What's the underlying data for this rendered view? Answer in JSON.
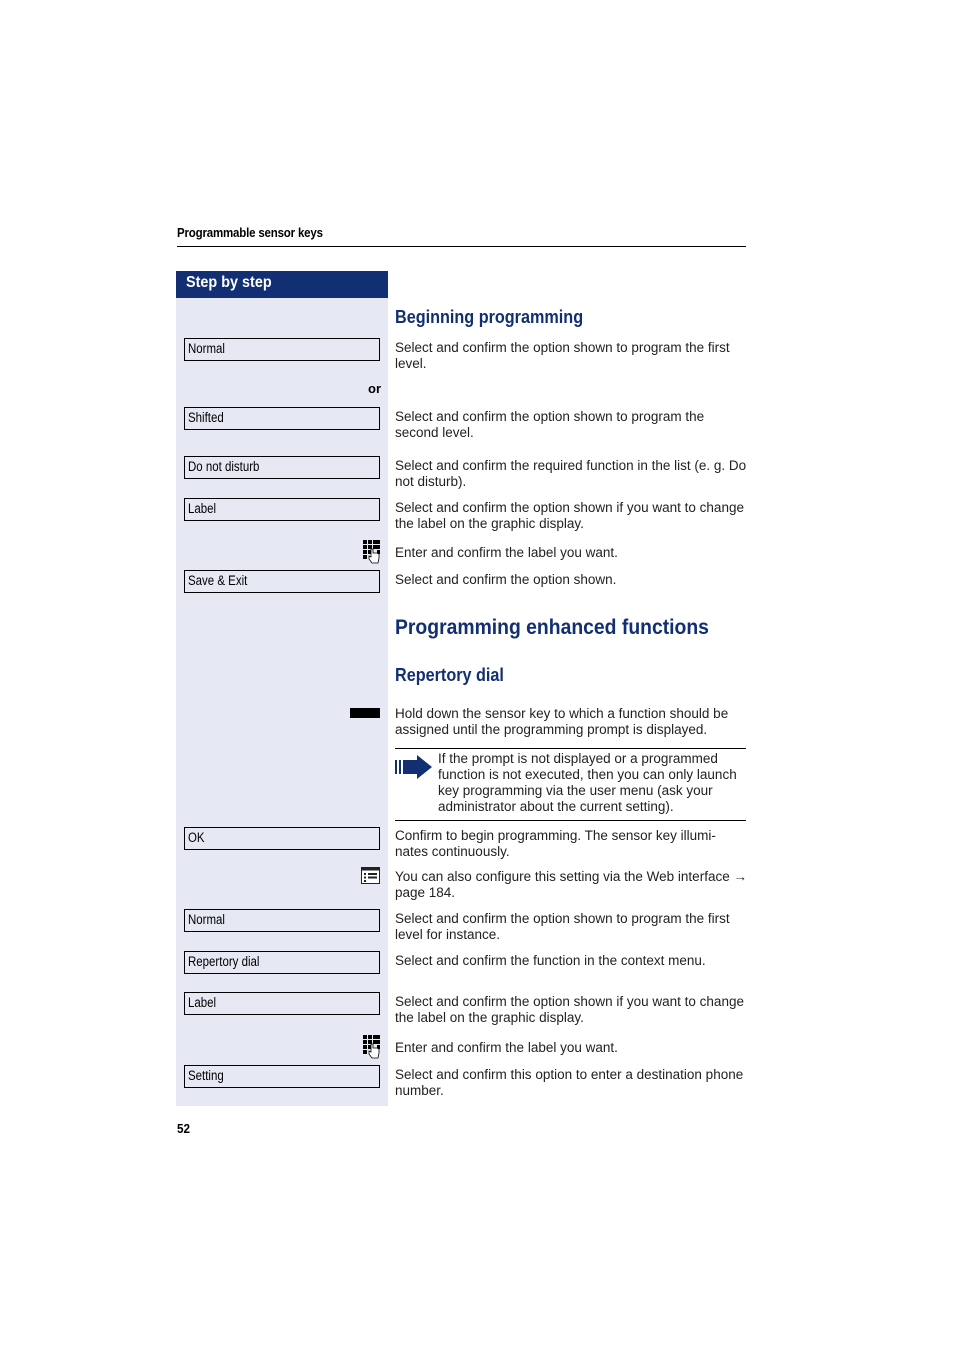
{
  "running_head": "Programmable sensor keys",
  "sidebar": {
    "title": "Step by step"
  },
  "colors": {
    "accent": "#132f73",
    "sidebar_bg": "#e6e9f3"
  },
  "sections": {
    "beginning_programming": {
      "heading": "Beginning programming",
      "steps": [
        {
          "key": "Normal",
          "text": "Select and confirm the option shown to program the first level."
        },
        {
          "connector": "or"
        },
        {
          "key": "Shifted",
          "text": "Select and confirm the option shown to program the second level."
        },
        {
          "key": "Do not disturb",
          "text": "Select and confirm the required function in the list (e. g. Do not disturb)."
        },
        {
          "key": "Label",
          "text": "Select and confirm the option shown if you want to change the label on the graphic display."
        },
        {
          "icon": "keypad-icon",
          "text": "Enter and confirm the label you want."
        },
        {
          "key": "Save & Exit",
          "text": "Select and confirm the option shown."
        }
      ]
    },
    "enhanced": {
      "heading": "Programming enhanced functions",
      "subheading": "Repertory dial",
      "steps": [
        {
          "icon": "sensor-key-icon",
          "text": "Hold down the sensor key to which a function should be assigned until the programming prompt is displayed."
        },
        {
          "note_icon": "arrow-note-icon",
          "note": "If the prompt is not displayed or a programmed function is not executed, then you can only launch key programming via the user menu (ask your administrator about the current setting)."
        },
        {
          "key": "OK",
          "text": "Confirm to begin programming. The sensor key illumi-nates continuously."
        },
        {
          "icon": "web-interface-icon",
          "text": "You can also configure this setting via the Web interface → page 184."
        },
        {
          "key": "Normal",
          "text": "Select and confirm the option shown to program the first level for instance."
        },
        {
          "key": "Repertory dial",
          "text": "Select and confirm the function in the context menu."
        },
        {
          "key": "Label",
          "text": "Select and confirm the option shown if you want to change the label on the graphic display."
        },
        {
          "icon": "keypad-icon",
          "text": "Enter and confirm the label you want."
        },
        {
          "key": "Setting",
          "text": "Select and confirm this option to enter a destination phone number."
        }
      ]
    }
  },
  "page_number": "52"
}
